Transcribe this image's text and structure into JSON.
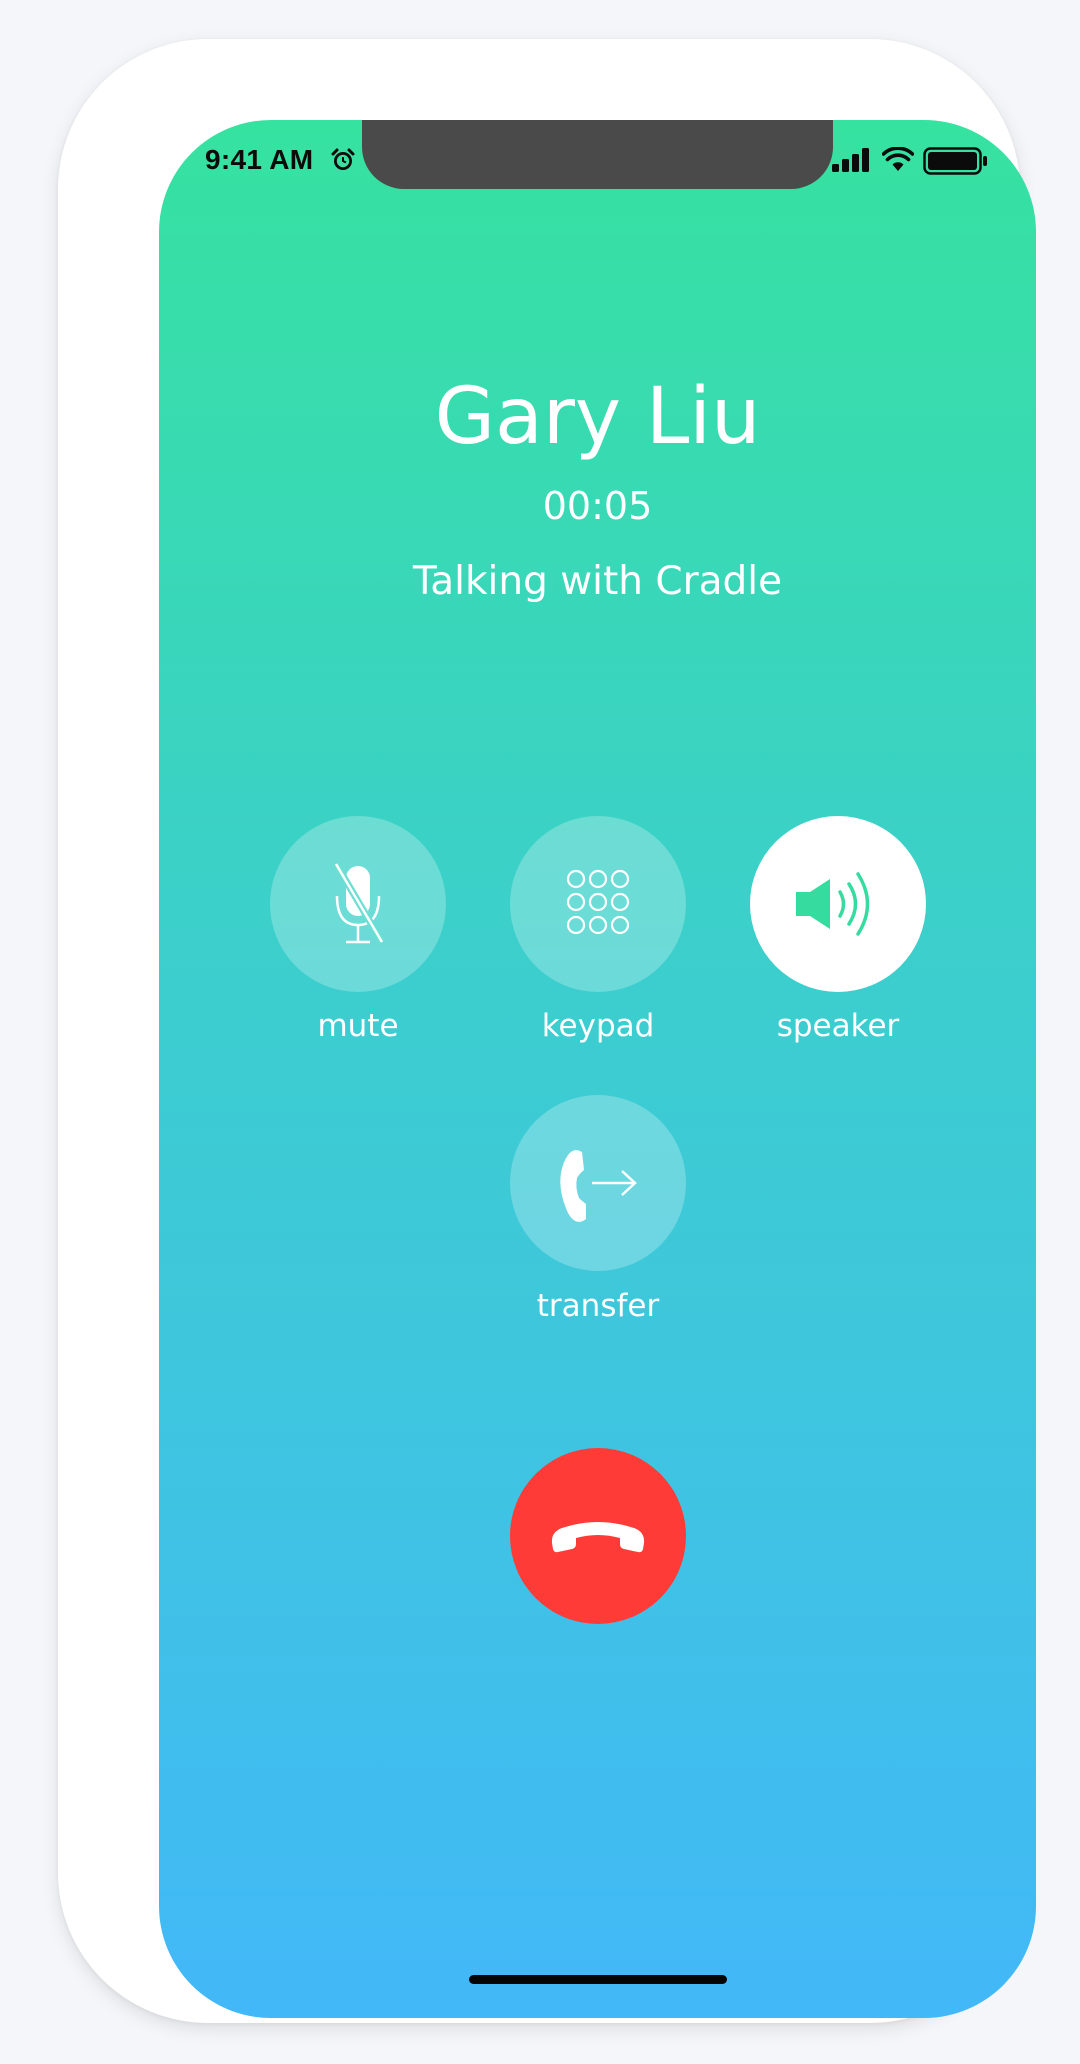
{
  "status_bar": {
    "time": "9:41 AM",
    "icons": [
      "alarm-icon",
      "signal-icon",
      "wifi-icon",
      "battery-icon"
    ]
  },
  "call": {
    "caller_name": "Gary Liu",
    "duration": "00:05",
    "subtitle": "Talking with Cradle"
  },
  "controls": {
    "mute": {
      "label": "mute",
      "icon": "microphone-muted-icon",
      "active": false
    },
    "keypad": {
      "label": "keypad",
      "icon": "keypad-icon",
      "active": false
    },
    "speaker": {
      "label": "speaker",
      "icon": "speaker-icon",
      "active": true
    },
    "transfer": {
      "label": "transfer",
      "icon": "call-transfer-icon",
      "active": false
    }
  },
  "end_call": {
    "icon": "end-call-icon"
  },
  "colors": {
    "gradient_top": "#36e2a0",
    "gradient_bottom": "#42b8f8",
    "end_call": "#fe3b36",
    "speaker_icon": "#36dba0"
  }
}
